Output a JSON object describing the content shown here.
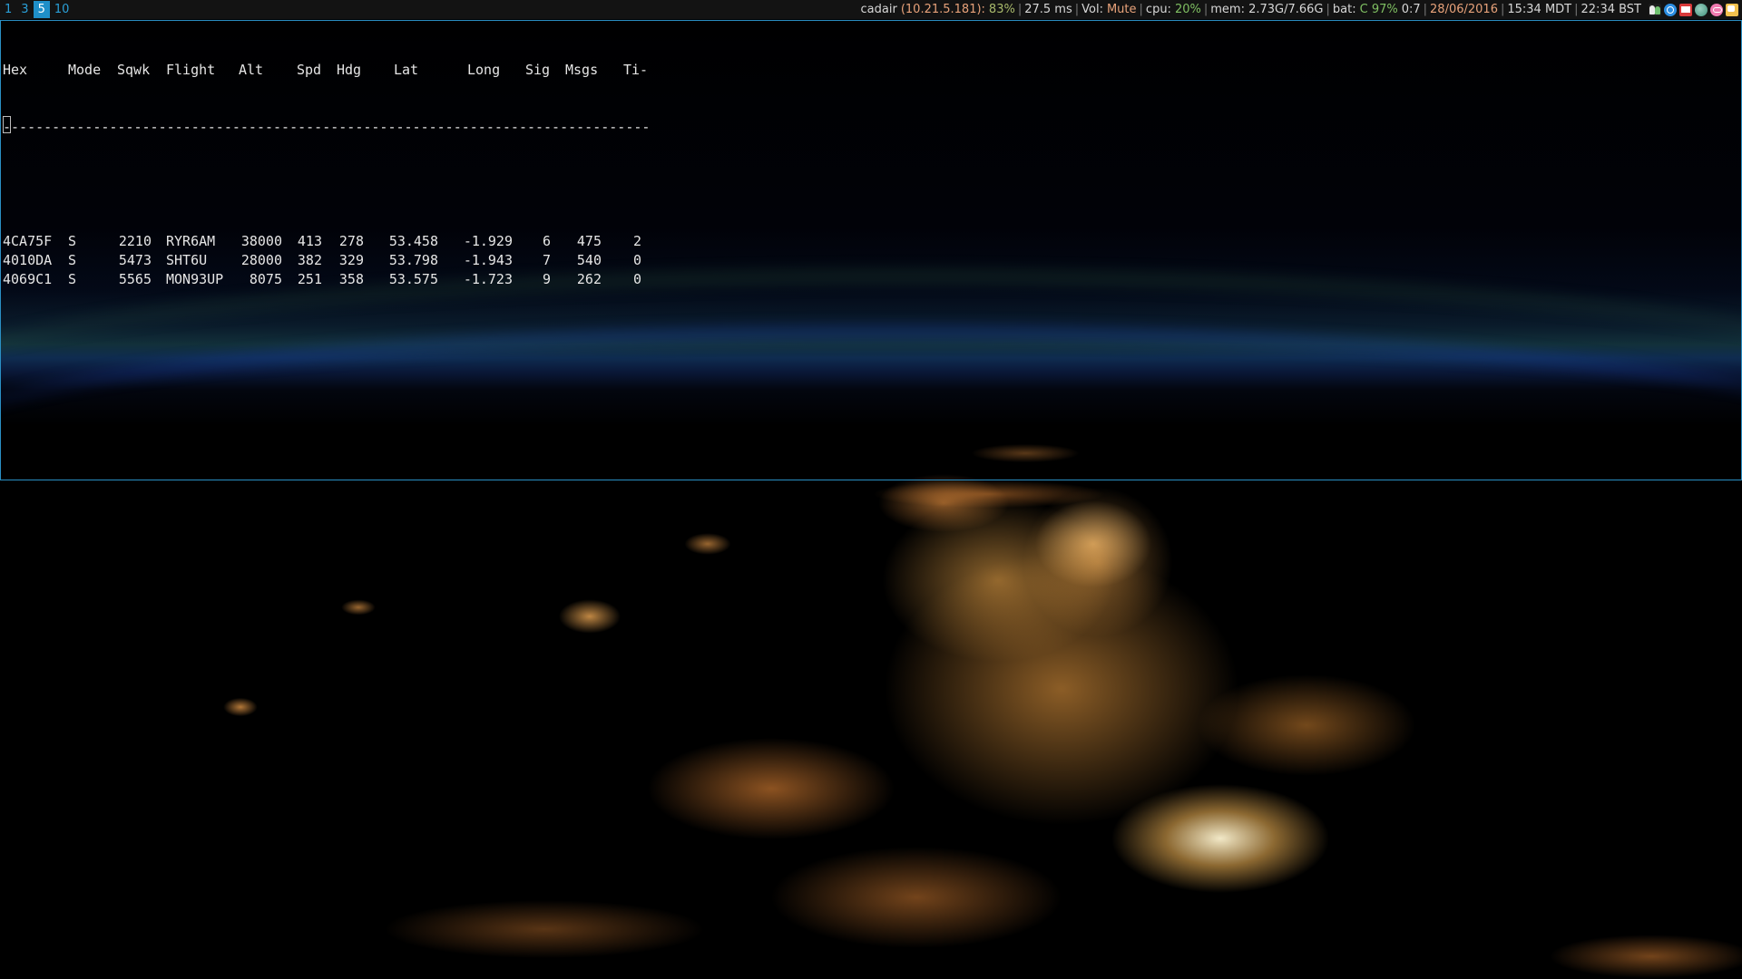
{
  "workspaces": [
    {
      "label": "1",
      "active": false
    },
    {
      "label": "3",
      "active": false
    },
    {
      "label": "5",
      "active": true
    },
    {
      "label": "10",
      "active": false
    }
  ],
  "statusbar": {
    "host": "cadair",
    "ip": "(10.21.5.181):",
    "wifi": "83%",
    "ping": "27.5 ms",
    "vol_label": "Vol:",
    "vol_value": "Mute",
    "cpu_label": "cpu:",
    "cpu_value": "20%",
    "mem": "mem: 2.73G/7.66G",
    "bat_label": "bat:",
    "bat_value": "C 97%",
    "bat_time": "0:7",
    "date": "28/06/2016",
    "time_local": "15:34 MDT",
    "time_bst": "22:34 BST",
    "tray_icons": [
      "people-icon",
      "sync-icon",
      "mail-icon",
      "globe-icon",
      "pink-app-icon",
      "chat-icon"
    ]
  },
  "terminal": {
    "headers": [
      "Hex",
      "Mode",
      "Sqwk",
      "Flight",
      "Alt",
      "Spd",
      "Hdg",
      "Lat",
      "Long",
      "Sig",
      "Msgs",
      "Ti-"
    ],
    "separator": "--------------------------------------------------------------------------------",
    "rows": [
      [
        "4CA75F",
        "S",
        "2210",
        "RYR6AM",
        "38000",
        "413",
        "278",
        "53.458",
        "-1.929",
        "6",
        "475",
        "2"
      ],
      [
        "4010DA",
        "S",
        "5473",
        "SHT6U",
        "28000",
        "382",
        "329",
        "53.798",
        "-1.943",
        "7",
        "540",
        "0"
      ],
      [
        "4069C1",
        "S",
        "5565",
        "MON93UP",
        "8075",
        "251",
        "358",
        "53.575",
        "-1.723",
        "9",
        "262",
        "0"
      ]
    ]
  },
  "colors": {
    "workspace_active_bg": "#1f8fc9",
    "workspace_text": "#2aa0d8",
    "terminal_border": "#2a8fc4",
    "status_highlight": "#e8a27a"
  }
}
